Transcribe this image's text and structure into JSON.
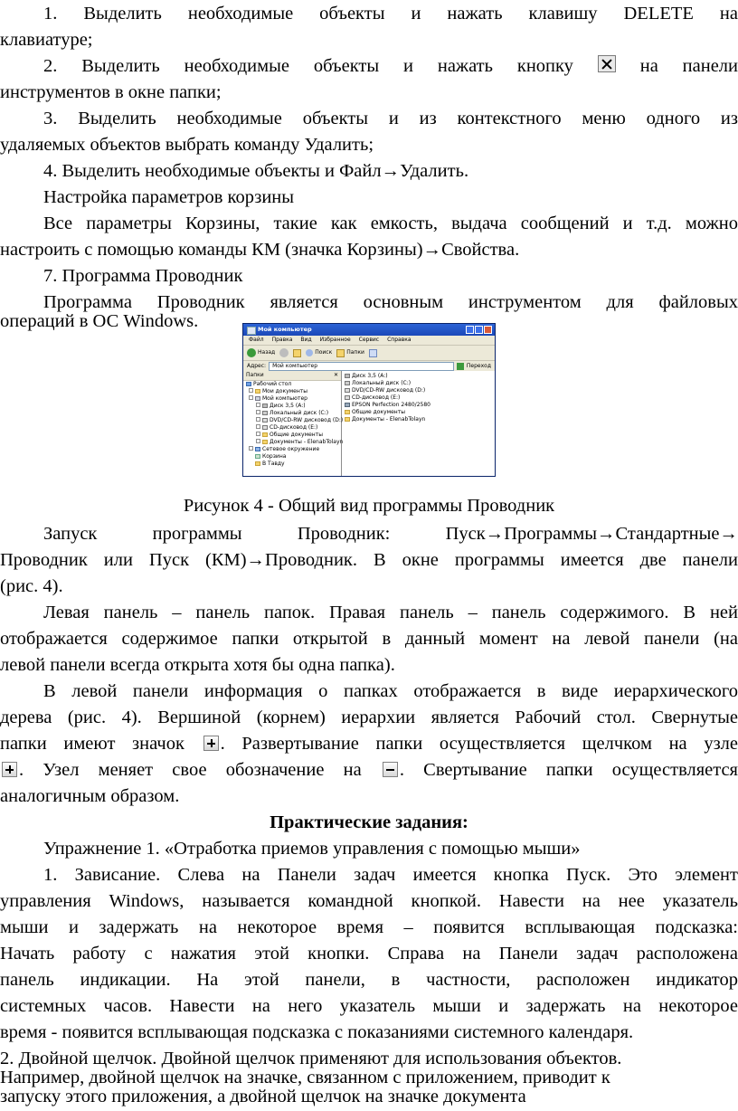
{
  "text": {
    "l1a": "1. Выделить необходимые объекты и нажать клавишу DELETE на",
    "l1b": "клавиатуре;",
    "l2a_pre": "2. Выделить необходимые объекты и нажать кнопку",
    "l2a_post": "на панели",
    "l2b": "инструментов в окне папки;",
    "l3a": "3. Выделить необходимые объекты и из контекстного меню одного из",
    "l3b": "удаляемых объектов выбрать команду Удалить;",
    "l4": "4. Выделить необходимые объекты и Файл→Удалить.",
    "h_trash": "Настройка параметров корзины",
    "t1a": "Все параметры Корзины, такие как емкость, выдача сообщений и т.д. можно",
    "t1b": "настроить с помощью команды КМ (значка Корзины)→Свойства.",
    "h_explorer": "7. Программа Проводник",
    "e1a": "Программа Проводник является основным инструментом для файловых",
    "e1b": "операций в ОС Windows.",
    "caption": "Рисунок 4 - Общий вид программы Проводник",
    "p1a": "Запуск программы Проводник: Пуск→Программы→Стандартные→",
    "p1b": "Проводник или Пуск (КМ)→Проводник. В окне программы имеется две панели",
    "p1c": "(рис. 4).",
    "p2a": "Левая панель – панель папок. Правая панель – панель содержимого. В ней",
    "p2b": "отображается содержимое папки открытой в данный момент на левой панели (на",
    "p2c": "левой панели всегда открыта хотя бы одна папка).",
    "p3a": "В левой панели информация о папках отображается в виде иерархического",
    "p3b": "дерева (рис. 4). Вершиной (корнем) иерархии является Рабочий стол. Свернутые",
    "p3c_pre": "папки имеют значок",
    "p3c_post": ". Развертывание папки осуществляется щелчком на узле",
    "p3d_mid": ". Узел меняет свое обозначение на",
    "p3d_post": ". Свертывание папки осуществляется",
    "p3e": "аналогичным образом.",
    "h_practice": "Практические задания:",
    "ex1": "Упражнение 1. «Отработка приемов управления с помощью мыши»",
    "q1a": "1. Зависание. Слева на Панели задач имеется кнопка Пуск. Это элемент",
    "q1b": "управления Windows, называется командной кнопкой. Навести на нее указатель",
    "q1c": "мыши и задержать на некоторое время – появится всплывающая подсказка:",
    "q1d": "Начать работу с нажатия этой кнопки. Справа на Панели задач расположена",
    "q1e": "панель индикации. На этой панели, в частности, расположен индикатор",
    "q1f": "системных часов. Навести на него указатель мыши и задержать на некоторое",
    "q1g": "время - появится всплывающая подсказка с показаниями системного календаря.",
    "q2a": "2. Двойной щелчок. Двойной щелчок применяют для использования объектов.",
    "q2b": "Например, двойной щелчок на значке, связанном с приложением, приводит к",
    "q2c": "запуску этого приложения, а двойной щелчок на значке документа"
  },
  "explorer": {
    "title": "Мой компьютер",
    "menu": [
      "Файл",
      "Правка",
      "Вид",
      "Избранное",
      "Сервис",
      "Справка"
    ],
    "back": "Назад",
    "search": "Поиск",
    "folders_btn": "Папки",
    "address_label": "Адрес:",
    "address_value": "Мой компьютер",
    "go": "Переход",
    "panel_title": "Папки",
    "tree": [
      "Рабочий стол",
      "Мои документы",
      "Мой компьютер",
      "Диск 3,5 (A:)",
      "Локальный диск (C:)",
      "DVD/CD-RW дисковод (D:)",
      "CD-дисковод (E:)",
      "Общие документы",
      "Документы - ElenabTolayn",
      "Сетевое окружение",
      "Корзина",
      "В Тавду"
    ],
    "content": [
      "Диск 3,5 (A:)",
      "Локальный диск (C:)",
      "DVD/CD-RW дисковод (D:)",
      "CD-дисковод (E:)",
      "EPSON Perfection 2480/2580",
      "Общие документы",
      "Документы - ElenabTolayn"
    ]
  }
}
